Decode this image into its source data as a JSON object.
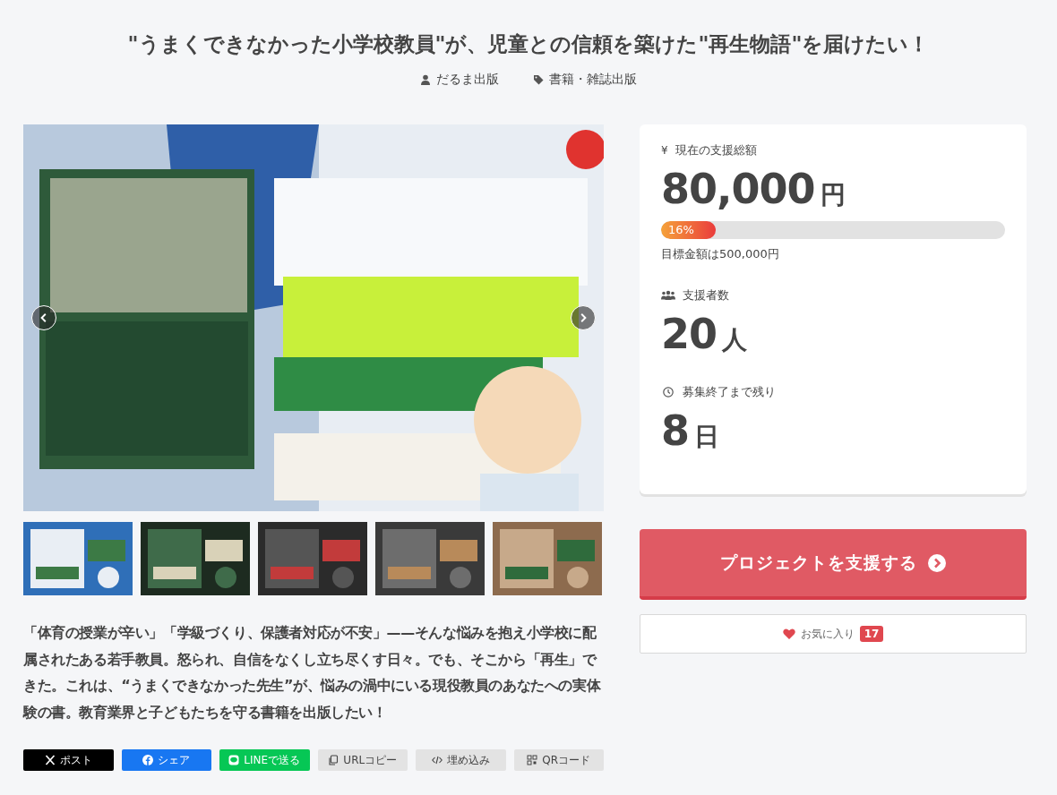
{
  "project": {
    "title": "\"うまくできなかった小学校教員\"が、児童との信頼を築けた\"再生物語\"を届けたい！",
    "owner": "だるま出版",
    "category": "書籍・雑誌出版"
  },
  "description": "「体育の授業が辛い」「学級づくり、保護者対応が不安」——そんな悩みを抱え小学校に配属されたある若手教員。怒られ、自信をなくし立ち尽くす日々。でも、そこから「再生」できた。これは、“うまくできなかった先生”が、悩みの渦中にいる現役教員のあなたへの実体験の書。教育業界と子どもたちを守る書籍を出版したい！",
  "share_buttons": [
    {
      "kind": "x",
      "label": "ポスト"
    },
    {
      "kind": "facebook",
      "label": "シェア"
    },
    {
      "kind": "line",
      "label": "LINEで送る"
    },
    {
      "kind": "copy",
      "label": "URLコピー"
    },
    {
      "kind": "embed",
      "label": "埋め込み"
    },
    {
      "kind": "qr",
      "label": "QRコード"
    }
  ],
  "stats": {
    "currency_symbol": "¥",
    "amount_label": "現在の支援総額",
    "amount": "80,000",
    "amount_unit": "円",
    "progress": {
      "level": 0.16,
      "label": "16%"
    },
    "goal": "目標金額は500,000円",
    "backers_label": "支援者数",
    "backers": "20",
    "backers_unit": "人",
    "remaining_label": "募集終了まで残り",
    "remaining": "8",
    "remaining_unit": "日"
  },
  "support_button": "プロジェクトを支援する",
  "favorite": {
    "label": "お気に入り",
    "count": "17"
  }
}
